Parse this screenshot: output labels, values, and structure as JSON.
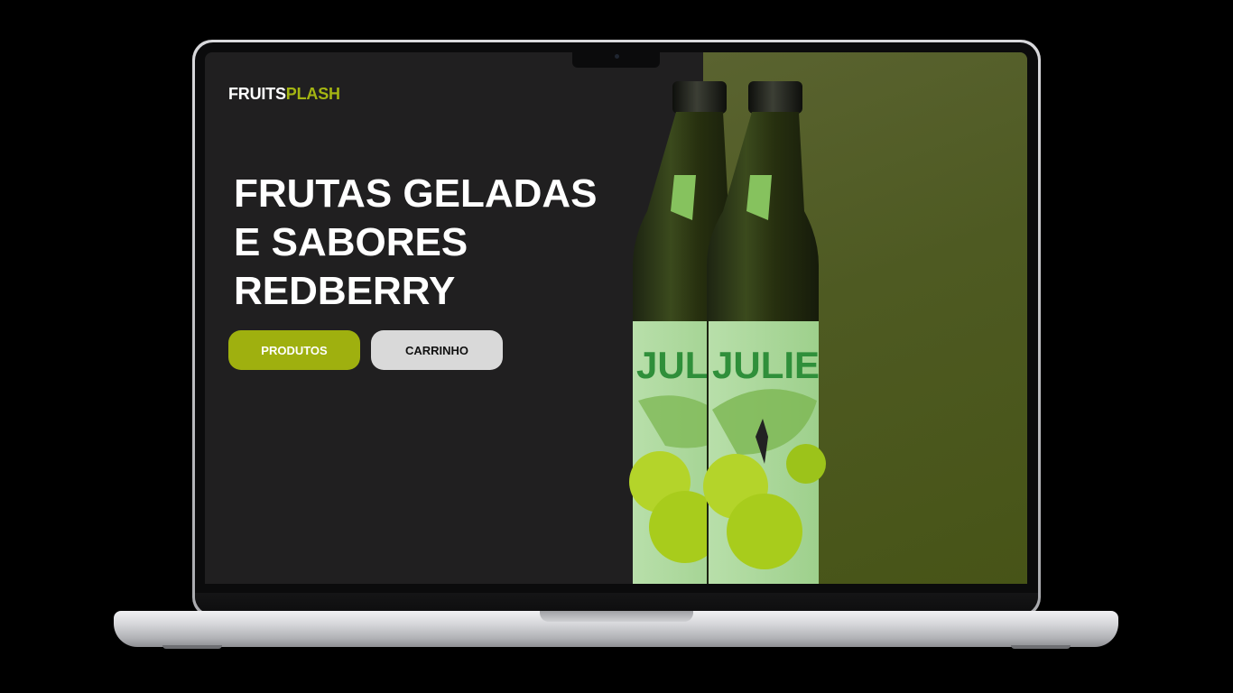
{
  "brand": {
    "name_part1": "FRUITS",
    "name_part2": "PLASH"
  },
  "hero": {
    "headline_line1": "FRUTAS GELADAS",
    "headline_line2": "E SABORES",
    "headline_line3": "REDBERRY"
  },
  "actions": {
    "products_label": "PRODUTOS",
    "cart_label": "CARRINHO"
  },
  "product_image": {
    "label_text": "JULIE"
  },
  "colors": {
    "accent": "#9fb00f",
    "screen_background": "#201f20",
    "photo_background": "#4e5a22",
    "secondary_button": "#d9d9d9"
  }
}
